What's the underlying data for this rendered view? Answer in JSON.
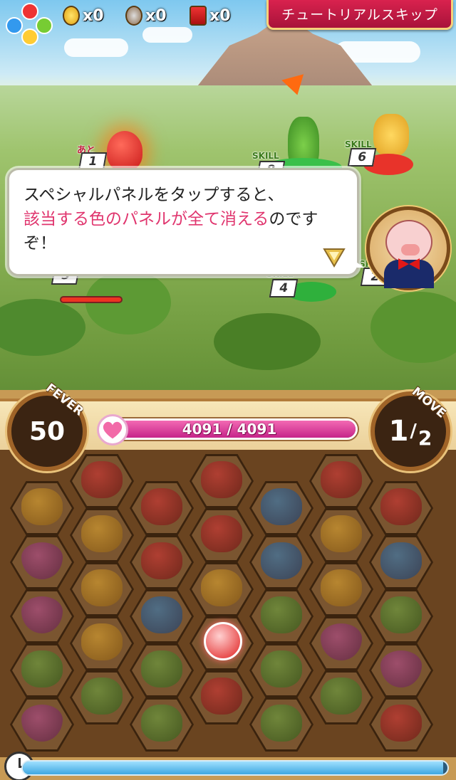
{
  "header": {
    "skip_button": "チュートリアルスキップ",
    "counters": [
      {
        "icon": "gold-egg-icon",
        "value": "x0"
      },
      {
        "icon": "silver-egg-icon",
        "value": "x0"
      },
      {
        "icon": "treasure-chest-icon",
        "value": "x0"
      }
    ]
  },
  "enemies": [
    {
      "label": "あと",
      "value": "1"
    },
    {
      "label": "SKILL",
      "value": "8"
    },
    {
      "label": "SKILL",
      "value": "6"
    },
    {
      "label": "あと",
      "value": "3"
    },
    {
      "label": "SKILL",
      "value": "4"
    },
    {
      "label": "SKILL",
      "value": "2"
    }
  ],
  "dialog": {
    "line1": "スペシャルパネルをタップすると、",
    "line2_highlight": "該当する色のパネルが全て消える",
    "line2_rest": "のです",
    "line3": "ぞ！"
  },
  "status": {
    "fever_label": "FEVER",
    "fever_value": "50",
    "hp_text": "4091 / 4091",
    "hp_fraction": 1.0,
    "move_label": "MOVE",
    "move_value": "1",
    "move_total": "2",
    "timer_fraction": 0.99
  },
  "colors": {
    "skip_button": "#c51a46",
    "hp_fill": "#e040a0",
    "dialog_highlight": "#e0356e"
  },
  "board": [
    [
      "red",
      "red",
      "red",
      "orange",
      "red"
    ],
    [
      "blue",
      "red",
      "orange",
      "red",
      "orange",
      "heart"
    ],
    [
      "red",
      "blue",
      "blue",
      "orange",
      "orange",
      "orange",
      "heart"
    ],
    [
      "blue",
      "green",
      "green",
      "orange",
      "special",
      "heart"
    ],
    [
      "green",
      "green",
      "green",
      "heart",
      "green"
    ],
    [
      "red",
      "green",
      "heart",
      "green",
      "green",
      "red"
    ]
  ]
}
